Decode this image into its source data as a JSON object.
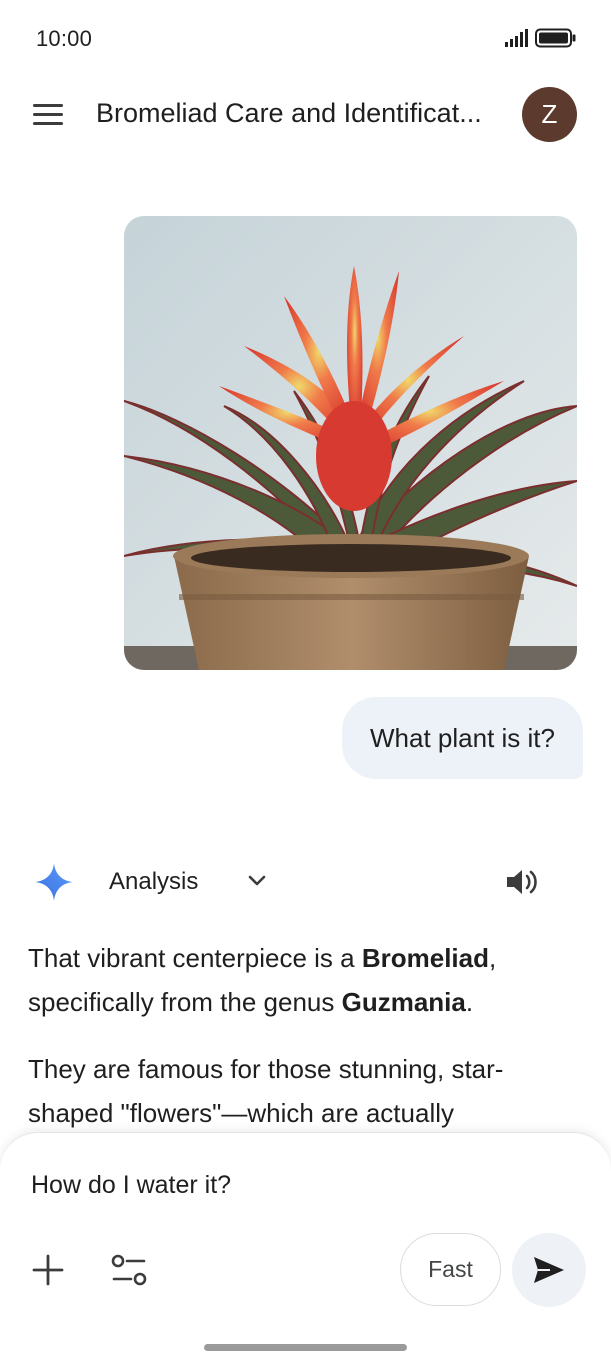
{
  "status_bar": {
    "time": "10:00",
    "icons": [
      "signal-icon",
      "battery-icon"
    ]
  },
  "header": {
    "menu_icon": "menu-icon",
    "title": "Bromeliad Care and Identificat...",
    "avatar_letter": "Z",
    "avatar_color": "#5d3a2e"
  },
  "conversation": {
    "user_image": "photo of a red Guzmania bromeliad in a terracotta pot",
    "user_message": "What plant is it?",
    "response_header": {
      "icon": "gemini-sparkle-icon",
      "mode_label": "Analysis",
      "dropdown_icon": "chevron-down-icon",
      "speaker_icon": "speaker-icon"
    },
    "response_paragraphs": [
      {
        "before": "That vibrant centerpiece is a ",
        "bold1": "Bromeliad",
        "middle": ", specifically from the genus ",
        "bold2": "Guzmania",
        "after": "."
      },
      {
        "text": "They are famous for those stunning, star-shaped \"flowers\"—which are actually"
      }
    ]
  },
  "composer": {
    "input_value": "How do I water it?",
    "plus_icon": "plus-icon",
    "tools_icon": "tools-icon",
    "fast_label": "Fast",
    "send_icon": "send-icon"
  },
  "colors": {
    "user_bubble": "#edf1f8",
    "gemini_blue": "#4285f4",
    "send_bg": "#eef1f6"
  }
}
